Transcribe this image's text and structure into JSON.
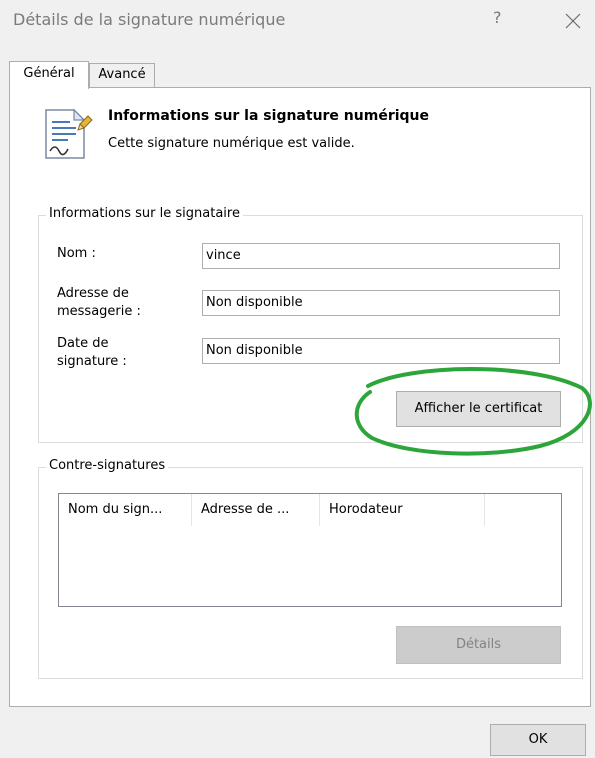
{
  "window": {
    "title": "Détails de la signature numérique",
    "help_glyph": "?",
    "close_icon": "close-icon"
  },
  "tabs": [
    {
      "label": "Général",
      "active": true
    },
    {
      "label": "Avancé",
      "active": false
    }
  ],
  "header": {
    "icon": "signed-document-icon",
    "title": "Informations sur la signature numérique",
    "subtitle": "Cette signature numérique est valide."
  },
  "signer_info": {
    "legend": "Informations sur le signataire",
    "name_label": "Nom :",
    "name_value": "vince",
    "email_label_line1": "Adresse de",
    "email_label_line2": "messagerie :",
    "email_value": "Non disponible",
    "date_label_line1": "Date de",
    "date_label_line2": "signature :",
    "date_value": "Non disponible",
    "view_cert_button": "Afficher le certificat"
  },
  "countersignatures": {
    "legend": "Contre-signatures",
    "columns": [
      "Nom du sign...",
      "Adresse de ...",
      "Horodateur"
    ],
    "rows": [],
    "details_button": "Détails"
  },
  "footer": {
    "ok_button": "OK"
  },
  "colors": {
    "highlight_annotation": "#2ea53a",
    "window_bg": "#f0f0f0",
    "panel_bg": "#ffffff",
    "button_bg": "#e1e1e1",
    "disabled_text": "#838383"
  }
}
